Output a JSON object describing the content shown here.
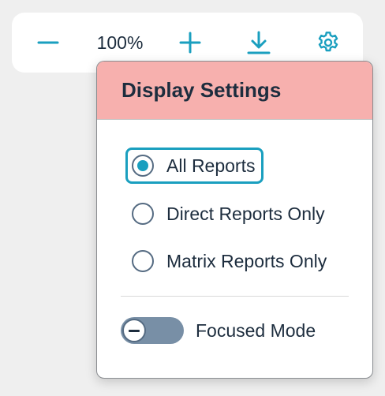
{
  "toolbar": {
    "zoom_level": "100%",
    "icons": {
      "zoom_out": "minus-icon",
      "zoom_in": "plus-icon",
      "download": "download-icon",
      "settings": "gear-icon"
    },
    "accent_color": "#1a9fbf"
  },
  "display_settings": {
    "title": "Display Settings",
    "header_color": "#f7b0ae",
    "options": [
      {
        "label": "All Reports",
        "selected": true
      },
      {
        "label": "Direct Reports Only",
        "selected": false
      },
      {
        "label": "Matrix Reports Only",
        "selected": false
      }
    ],
    "focused_mode": {
      "label": "Focused Mode",
      "on": false
    }
  }
}
